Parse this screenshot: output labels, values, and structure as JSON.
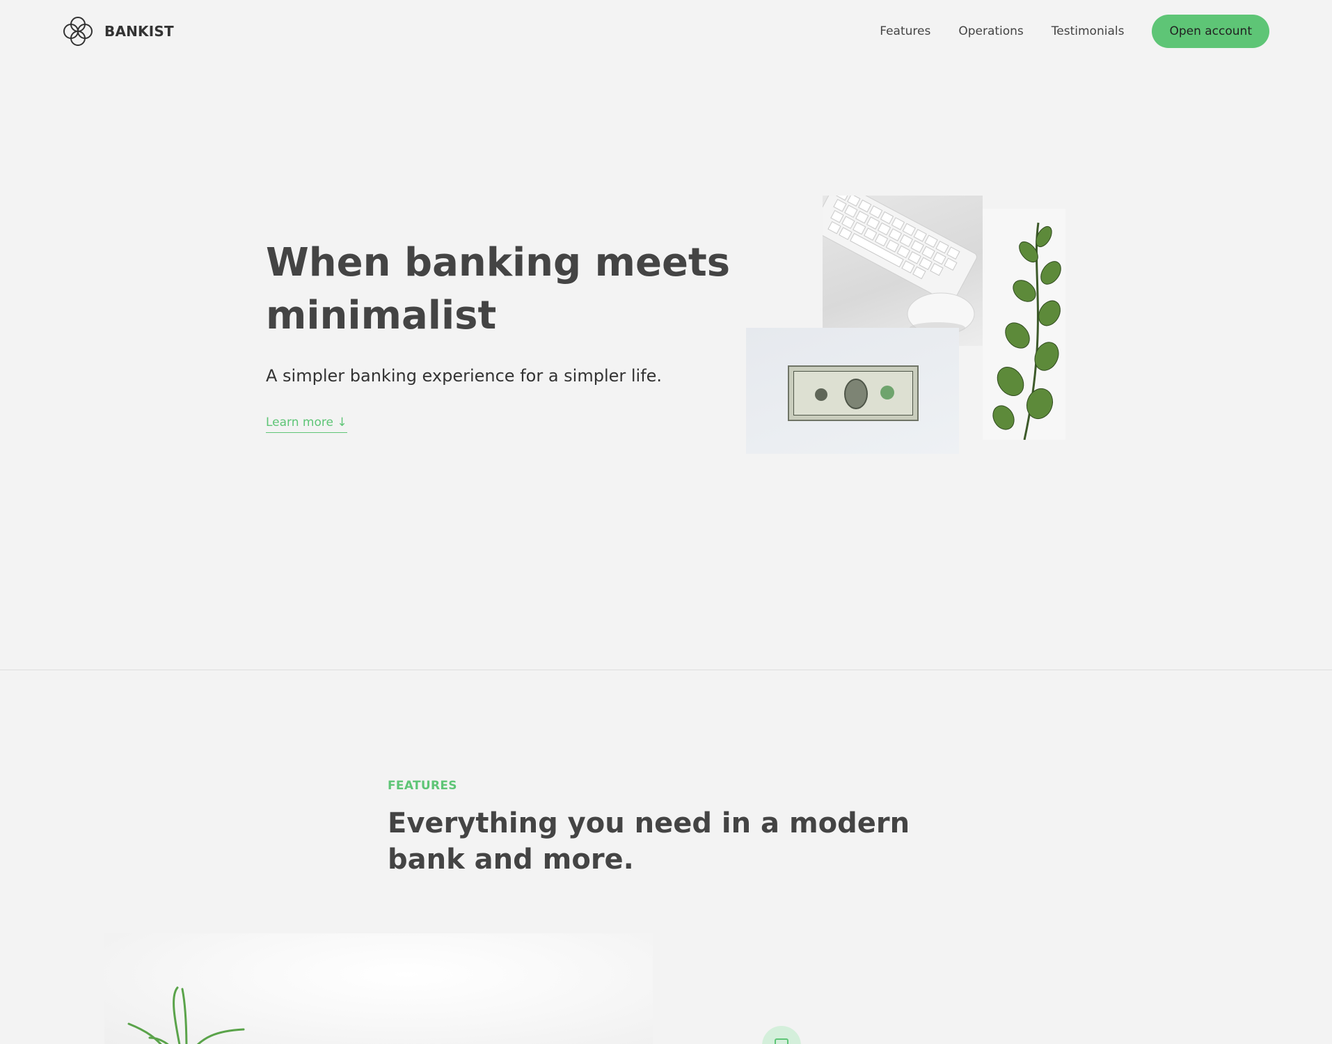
{
  "nav": {
    "logo_text": "BANKIST",
    "links": [
      "Features",
      "Operations",
      "Testimonials"
    ],
    "cta": "Open account"
  },
  "hero": {
    "title_part1": "When",
    "title_highlight1": "banking",
    "title_part2": "meets",
    "title_highlight2": "minimalist",
    "subtitle": "A simpler banking experience for a simpler life.",
    "learn_more": "Learn more ↓",
    "images": [
      "keyboard-mouse",
      "dollar-bill",
      "eucalyptus-plant"
    ]
  },
  "features": {
    "label": "FEATURES",
    "title": "Everything you need in a modern bank and more."
  },
  "colors": {
    "background": "#f3f3f3",
    "accent": "#5ec576",
    "text": "#444444",
    "highlight_gradient": [
      "#9be15d",
      "#39b385"
    ]
  }
}
